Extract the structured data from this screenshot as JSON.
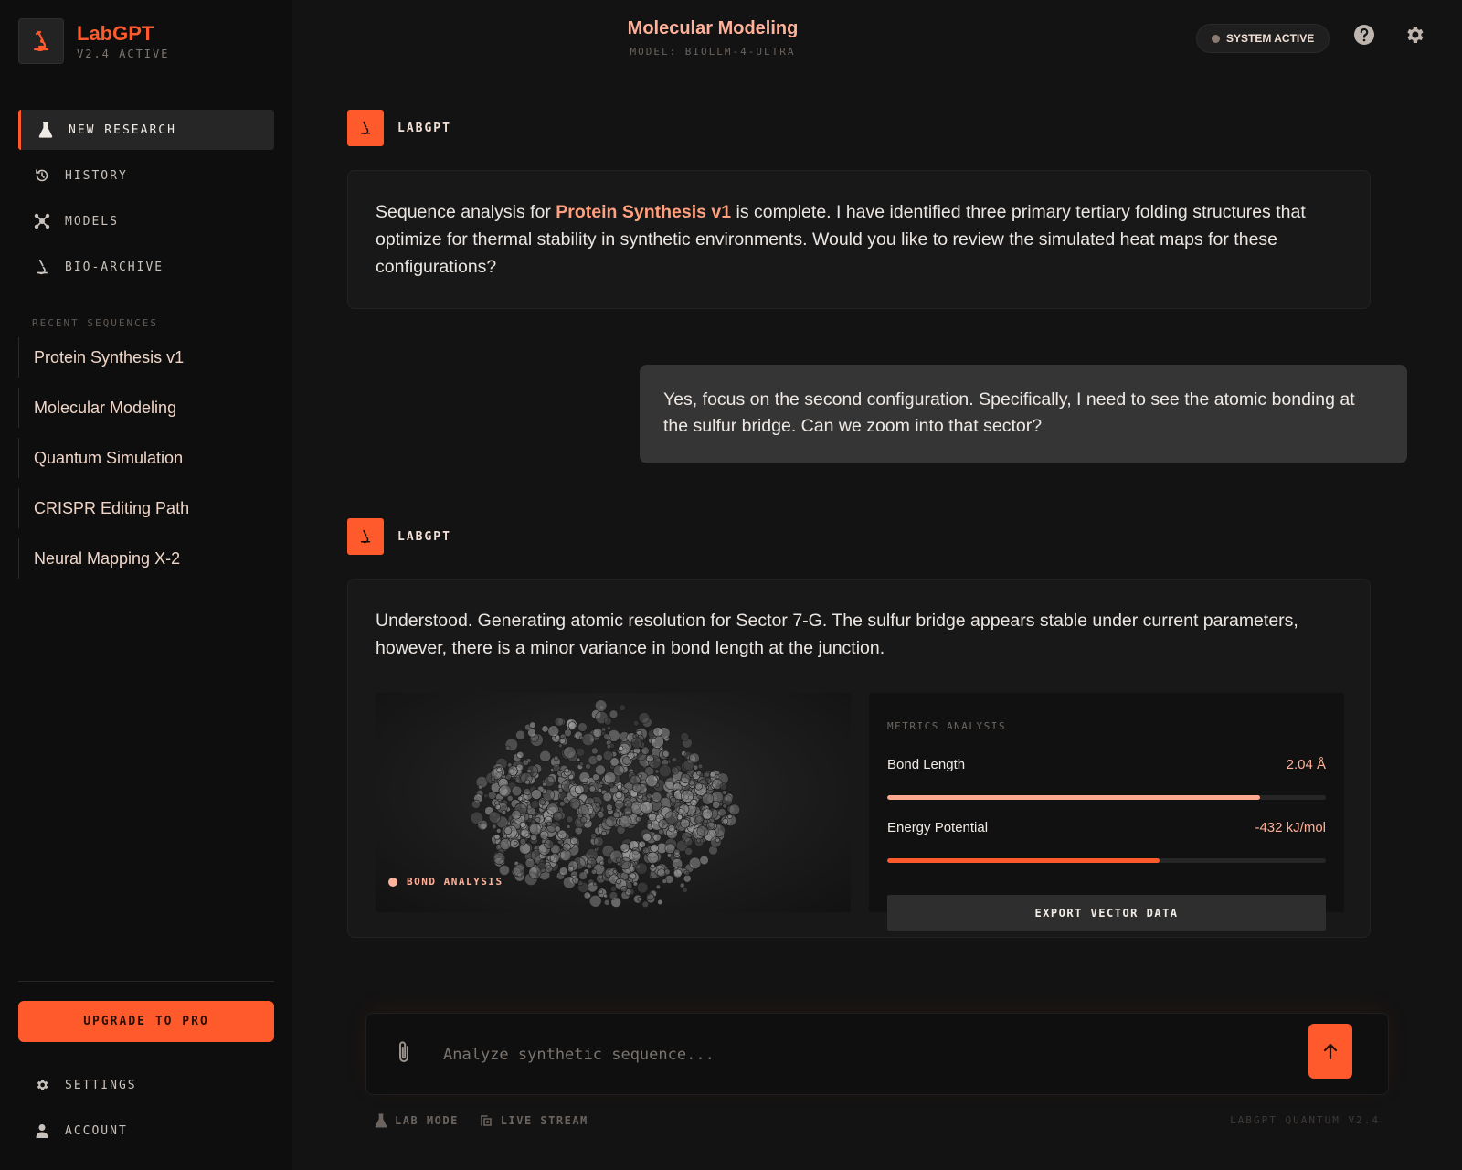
{
  "brand": {
    "name": "LabGPT",
    "version": "V2.4 ACTIVE"
  },
  "nav": [
    {
      "label": "NEW RESEARCH",
      "icon": "flask-icon",
      "active": true
    },
    {
      "label": "HISTORY",
      "icon": "history-icon"
    },
    {
      "label": "MODELS",
      "icon": "molecule-icon"
    },
    {
      "label": "BIO-ARCHIVE",
      "icon": "microscope-icon"
    }
  ],
  "recent": {
    "title": "RECENT SEQUENCES",
    "items": [
      "Protein Synthesis v1",
      "Molecular Modeling",
      "Quantum Simulation",
      "CRISPR Editing Path",
      "Neural Mapping X-2"
    ]
  },
  "upgrade_label": "UPGRADE TO PRO",
  "bottom_nav": [
    {
      "label": "SETTINGS",
      "icon": "gear-icon"
    },
    {
      "label": "ACCOUNT",
      "icon": "user-icon"
    }
  ],
  "header": {
    "title": "Molecular Modeling",
    "subtitle": "MODEL: BIOLLM-4-ULTRA",
    "status": "SYSTEM ACTIVE"
  },
  "messages": {
    "ai_author": "LABGPT",
    "first": {
      "before": "Sequence analysis for ",
      "highlight": "Protein Synthesis v1",
      "after": " is complete. I have identified three primary tertiary folding structures that optimize for thermal stability in synthetic environments. Would you like to review the simulated heat maps for these configurations?"
    },
    "user": "Yes, focus on the second configuration. Specifically, I need to see the atomic bonding at the sulfur bridge. Can we zoom into that sector?",
    "second": "Understood. Generating atomic resolution for Sector 7-G. The sulfur bridge appears stable under current parameters, however, there is a minor variance in bond length at the junction."
  },
  "visualization": {
    "label": "BOND ANALYSIS"
  },
  "metrics": {
    "title": "METRICS ANALYSIS",
    "items": [
      {
        "name": "Bond Length",
        "value": "2.04 Å",
        "progress": 0.85,
        "color": "#ffa98f"
      },
      {
        "name": "Energy Potential",
        "value": "-432 kJ/mol",
        "progress": 0.62,
        "color": "#ff5a2c"
      }
    ],
    "export_label": "EXPORT VECTOR DATA"
  },
  "composer": {
    "placeholder": "Analyze synthetic sequence..."
  },
  "footer": {
    "lab_mode": "LAB MODE",
    "live_stream": "LIVE STREAM",
    "version": "LABGPT QUANTUM V2.4"
  },
  "colors": {
    "accent": "#ff5a2c",
    "accent_light": "#ffb199",
    "background": "#131313",
    "sidebar": "#0e0e0e"
  }
}
